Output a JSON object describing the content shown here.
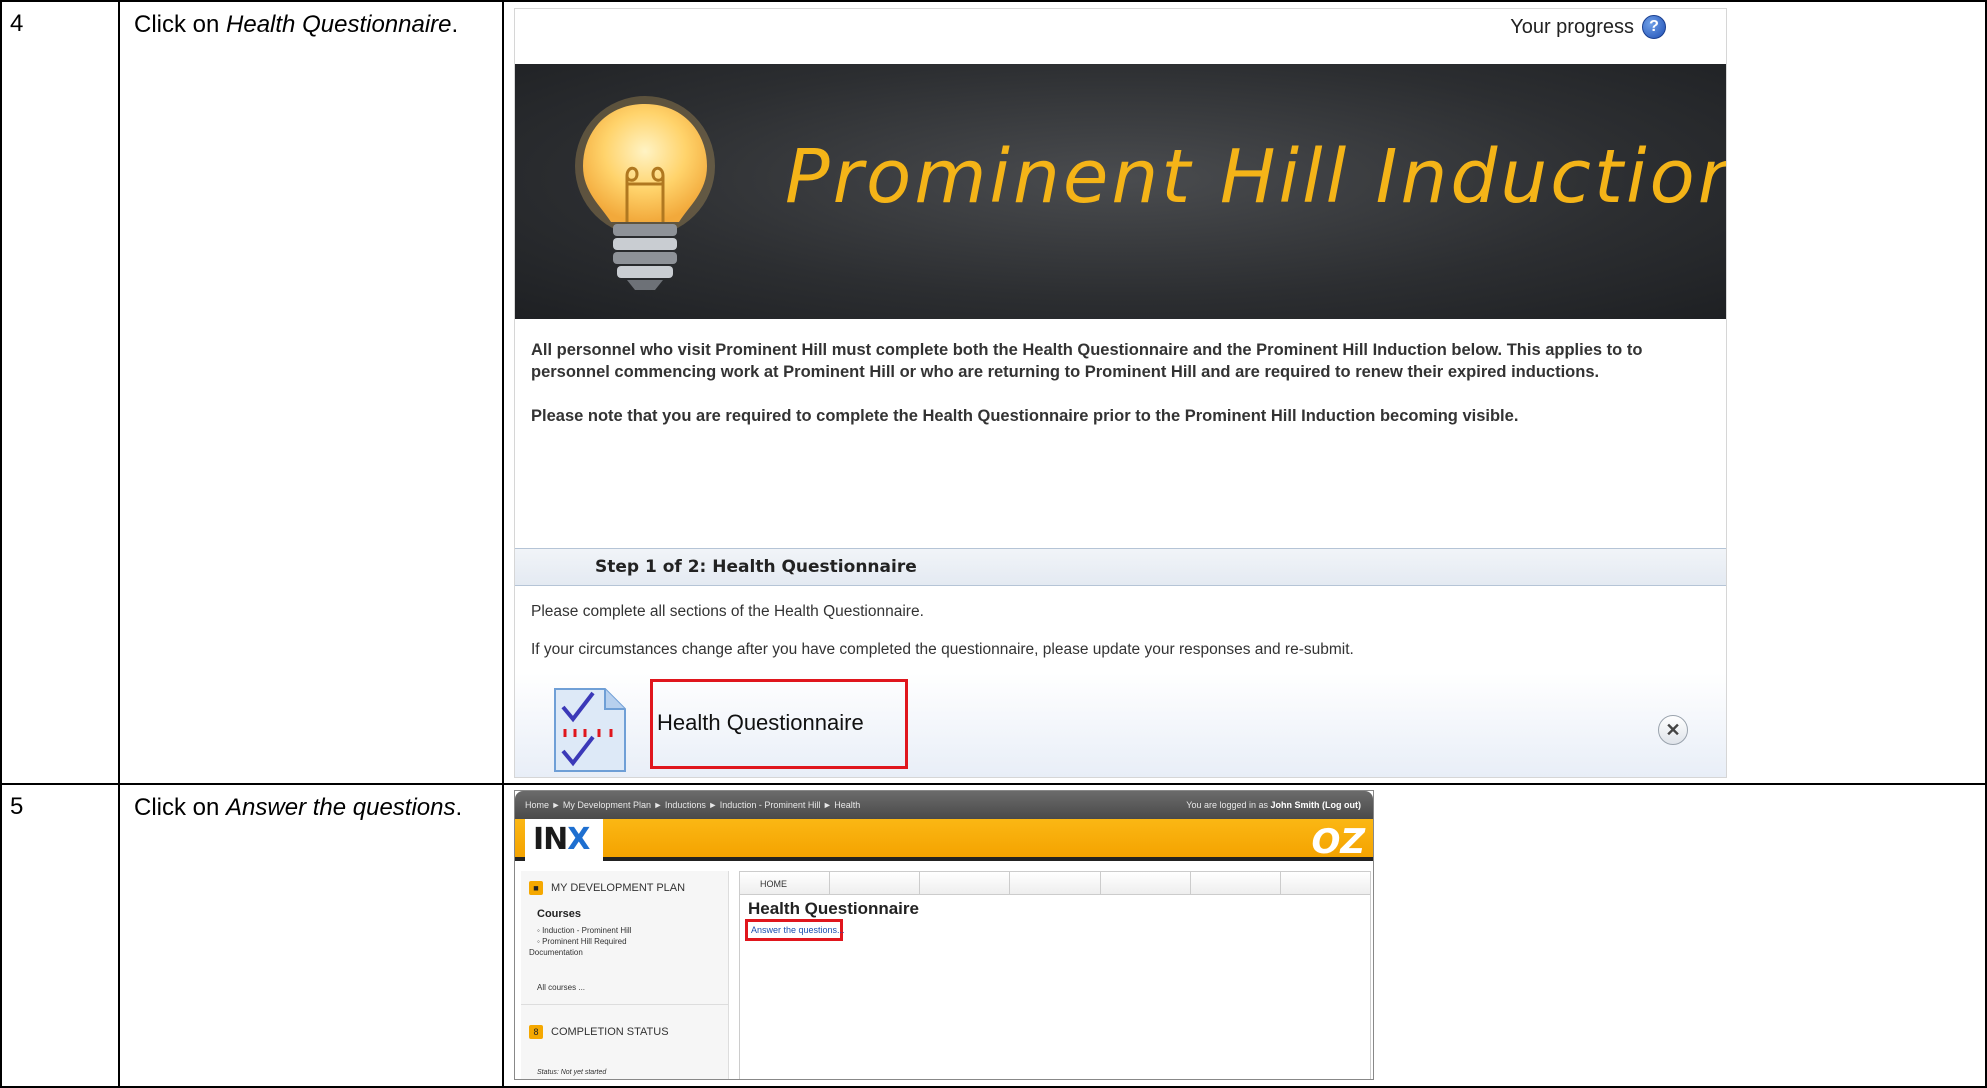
{
  "steps": [
    {
      "number": "4",
      "text_prefix": "Click on ",
      "text_target": "Health Questionnaire",
      "text_suffix": "."
    },
    {
      "number": "5",
      "text_prefix": "Click on ",
      "text_target": "Answer the questions",
      "text_suffix": "."
    }
  ],
  "shot1": {
    "progress_label": "Your progress",
    "progress_icon": "help-icon",
    "banner_title": "Prominent Hill Induction",
    "intro_p1": "All personnel who visit Prominent Hill must complete both the Health Questionnaire and the Prominent Hill Induction below. This applies to to personnel commencing work at Prominent Hill or who are returning to Prominent Hill and are required to renew their expired inductions.",
    "intro_p2": "Please note that you are required to complete the Health Questionnaire prior to the Prominent Hill Induction becoming visible.",
    "step_header": "Step 1 of 2: Health Questionnaire",
    "step_desc_1": "Please complete all sections of the Health Questionnaire.",
    "step_desc_2": "If your circumstances change after you have completed the questionnaire, please update your responses and re-submit.",
    "activity_label": "Health Questionnaire",
    "activity_icon": "questionnaire-icon",
    "close_symbol": "✕",
    "accent_color": "#e0161d",
    "banner_text_color": "#f4b418"
  },
  "shot2": {
    "breadcrumb": "Home ► My Development Plan ► Inductions ► Induction - Prominent Hill ► Health",
    "login_prefix": "You are logged in as ",
    "login_user": "John Smith",
    "login_suffix": " (Log out)",
    "logo_left_main": "IN",
    "logo_left_x": "X",
    "logo_right": "OZ",
    "brand_color": "#f4a300",
    "sidebar_title_1": "MY DEVELOPMENT PLAN",
    "courses_label": "Courses",
    "course_items": [
      "Induction - Prominent Hill",
      "Prominent Hill Required",
      "Documentation"
    ],
    "all_courses": "All courses ...",
    "sidebar_title_2": "COMPLETION STATUS",
    "status_text": "Status: Not yet started",
    "tabs": [
      "HOME",
      "",
      "",
      "",
      "",
      "",
      ""
    ],
    "heading": "Health Questionnaire",
    "answer_link": "Answer the questions..."
  }
}
